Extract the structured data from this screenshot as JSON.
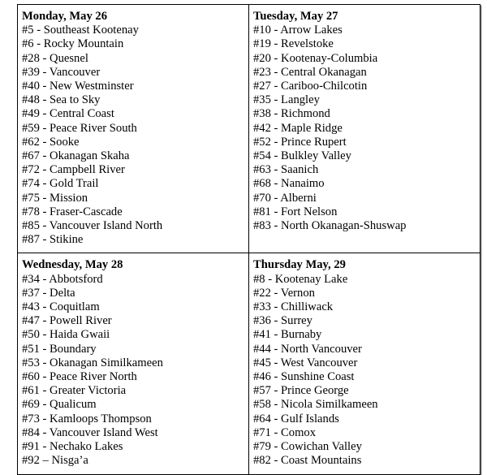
{
  "document": {
    "type": "school-district-schedule-table",
    "columns": 2,
    "rows": 2
  },
  "cells": [
    {
      "heading": "Monday, May 26",
      "districts": [
        "#5 - Southeast Kootenay",
        "#6 - Rocky Mountain",
        "#28 - Quesnel",
        "#39 - Vancouver",
        "#40 - New Westminster",
        "#48 - Sea to Sky",
        "#49 - Central Coast",
        "#59 - Peace River South",
        "#62 - Sooke",
        "#67 - Okanagan Skaha",
        "#72 - Campbell River",
        "#74 - Gold Trail",
        "#75 - Mission",
        "#78 - Fraser-Cascade",
        "#85 - Vancouver Island North",
        "#87 - Stikine"
      ]
    },
    {
      "heading": "Tuesday, May 27",
      "districts": [
        "#10 - Arrow Lakes",
        "#19 - Revelstoke",
        "#20 - Kootenay-Columbia",
        "#23 - Central Okanagan",
        "#27 - Cariboo-Chilcotin",
        "#35 - Langley",
        "#38 - Richmond",
        "#42 - Maple Ridge",
        "#52 - Prince Rupert",
        "#54 - Bulkley Valley",
        "#63 - Saanich",
        "#68 - Nanaimo",
        "#70 - Alberni",
        "#81 - Fort Nelson",
        "#83 - North Okanagan-Shuswap"
      ]
    },
    {
      "heading": "Wednesday, May 28",
      "districts": [
        "#34 - Abbotsford",
        "#37 - Delta",
        "#43 - Coquitlam",
        "#47 - Powell River",
        "#50 - Haida Gwaii",
        "#51 - Boundary",
        "#53 - Okanagan Similkameen",
        "#60 - Peace River North",
        "#61 - Greater Victoria",
        "#69 - Qualicum",
        "#73 - Kamloops Thompson",
        "#84 - Vancouver Island West",
        "#91 - Nechako Lakes",
        "#92 – Nisga’a"
      ]
    },
    {
      "heading": "Thursday May, 29",
      "districts": [
        "#8 - Kootenay Lake",
        "#22 - Vernon",
        "#33 - Chilliwack",
        "#36 - Surrey",
        "#41 - Burnaby",
        "#44 - North Vancouver",
        "#45 - West Vancouver",
        "#46 - Sunshine Coast",
        "#57 - Prince George",
        "#58 - Nicola Similkameen",
        "#64 - Gulf Islands",
        "#71 - Comox",
        "#79 - Cowichan Valley",
        "#82 - Coast Mountains"
      ]
    }
  ],
  "colors": {
    "text": "#000000",
    "background": "#ffffff",
    "border": "#000000",
    "shadow": "#8a8a8a"
  }
}
